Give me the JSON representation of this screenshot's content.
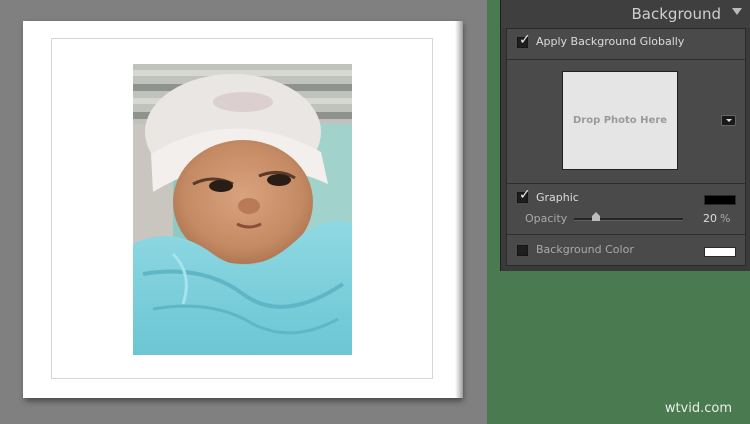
{
  "panel": {
    "title": "Background",
    "apply_globally": {
      "label": "Apply Background Globally",
      "checked": true
    },
    "drop_zone": {
      "text": "Drop Photo Here"
    },
    "graphic": {
      "label": "Graphic",
      "checked": true,
      "swatch_color": "#000000"
    },
    "opacity": {
      "label": "Opacity",
      "value": "20",
      "unit": "%",
      "fraction": 0.2
    },
    "background_color": {
      "label": "Background Color",
      "checked": false,
      "swatch_color": "#ffffff"
    }
  },
  "colors": {
    "canvas_bg": "#808080",
    "panel_bg": "#4a4a4a",
    "page_bg": "#ffffff",
    "surround_bg": "#4a7a4f"
  },
  "photo": {
    "subject": "newborn baby in white cap wrapped in light blue blanket"
  },
  "watermark": "wtvid.com"
}
